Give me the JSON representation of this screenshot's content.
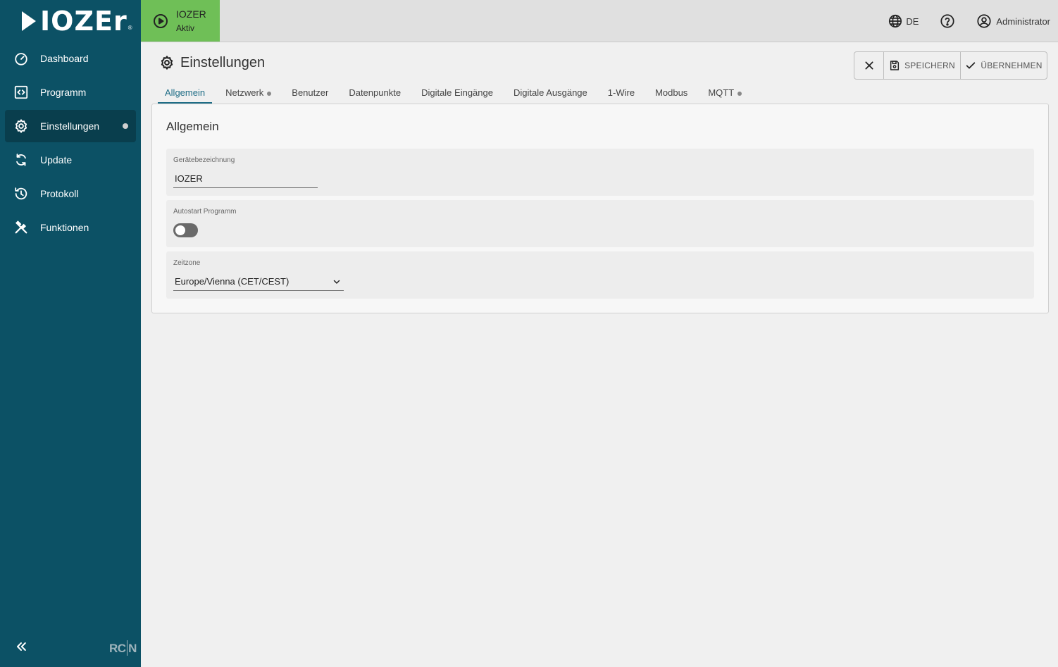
{
  "brand": {
    "logo_text": "IOZEr",
    "reg": "®",
    "footer_mark_left": "RC",
    "footer_mark_right": "N"
  },
  "sidebar": {
    "items": [
      {
        "label": "Dashboard",
        "icon": "speedometer-icon",
        "active": false
      },
      {
        "label": "Programm",
        "icon": "code-brackets-icon",
        "active": false
      },
      {
        "label": "Einstellungen",
        "icon": "gear-icon",
        "active": true,
        "dot": true
      },
      {
        "label": "Update",
        "icon": "refresh-icon",
        "active": false
      },
      {
        "label": "Protokoll",
        "icon": "history-icon",
        "active": false
      },
      {
        "label": "Funktionen",
        "icon": "tools-icon",
        "active": false
      }
    ],
    "collapse_icon": "double-chevron-left-icon"
  },
  "topbar": {
    "status": {
      "title": "IOZER",
      "subtitle": "Aktiv",
      "color": "#6fbf57",
      "icon": "play-circle-icon"
    },
    "language": "DE",
    "user": "Administrator"
  },
  "page": {
    "title": "Einstellungen",
    "actions": {
      "save": "SPEICHERN",
      "apply": "ÜBERNEHMEN"
    }
  },
  "tabs": [
    {
      "label": "Allgemein",
      "active": true,
      "dot": false
    },
    {
      "label": "Netzwerk",
      "active": false,
      "dot": true
    },
    {
      "label": "Benutzer",
      "active": false,
      "dot": false
    },
    {
      "label": "Datenpunkte",
      "active": false,
      "dot": false
    },
    {
      "label": "Digitale Eingänge",
      "active": false,
      "dot": false
    },
    {
      "label": "Digitale Ausgänge",
      "active": false,
      "dot": false
    },
    {
      "label": "1-Wire",
      "active": false,
      "dot": false
    },
    {
      "label": "Modbus",
      "active": false,
      "dot": false
    },
    {
      "label": "MQTT",
      "active": false,
      "dot": true
    }
  ],
  "card": {
    "title": "Allgemein",
    "device_name": {
      "label": "Gerätebezeichnung",
      "value": "IOZER"
    },
    "autostart": {
      "label": "Autostart Programm",
      "enabled": false
    },
    "timezone": {
      "label": "Zeitzone",
      "value": "Europe/Vienna (CET/CEST)"
    }
  },
  "colors": {
    "sidebar": "#0c5165",
    "sidebar_active": "#093e4d",
    "accent": "#1f6d86",
    "status_green": "#6fbf57"
  }
}
